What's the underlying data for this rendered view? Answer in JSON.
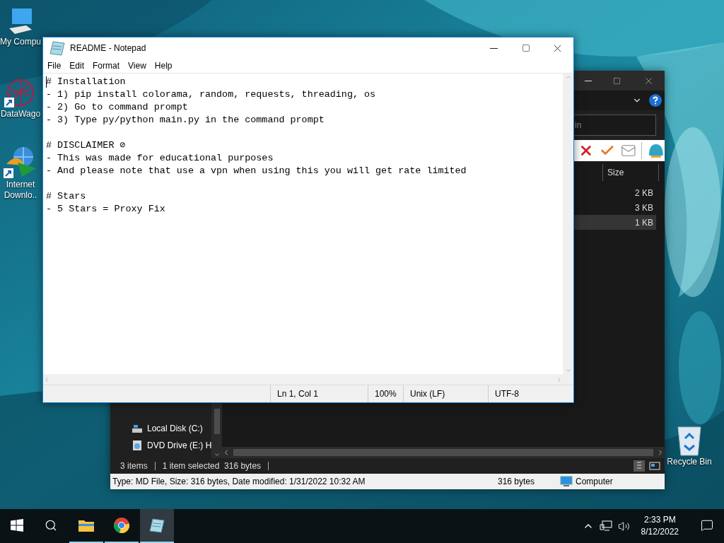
{
  "desktop_icons": [
    {
      "label": "My Compu",
      "kind": "computer"
    },
    {
      "label": "DataWago",
      "kind": "network"
    },
    {
      "label": "Internet Downlo..",
      "kind": "download"
    },
    {
      "label": "Recycle Bin",
      "kind": "recycle"
    }
  ],
  "explorer": {
    "search": {
      "placeholder": "in"
    },
    "columns": [
      "Size"
    ],
    "files": [
      {
        "size": "2 KB",
        "selected": false
      },
      {
        "size": "3 KB",
        "selected": false
      },
      {
        "size": "1 KB",
        "selected": true
      }
    ],
    "nav_items": [
      {
        "label": "Local Disk (C:)",
        "kind": "disk"
      },
      {
        "label": "DVD Drive (E:) H",
        "kind": "dvd"
      }
    ],
    "status_bar": {
      "count": "3 items",
      "selection": "1 item selected  316 bytes"
    },
    "details_bar": {
      "info": "Type: MD File, Size: 316 bytes, Date modified: 1/31/2022 10:32 AM",
      "size": "316 bytes",
      "location": "Computer"
    }
  },
  "notepad": {
    "title": "README - Notepad",
    "menu": [
      "File",
      "Edit",
      "Format",
      "View",
      "Help"
    ],
    "paragraphs": [
      [
        "# Installation",
        "- 1) pip install colorama, random, requests, threading, os",
        "- 2) Go to command prompt",
        "- 3) Type py/python main.py in the command prompt"
      ],
      [
        "# DISCLAIMER ⊘",
        "- This was made for educational purposes",
        "- And please note that use a vpn when using this you will get rate limited"
      ],
      [
        "# Stars",
        "- 5 Stars = Proxy Fix"
      ]
    ],
    "status": {
      "position": "Ln 1, Col 1",
      "zoom": "100%",
      "line_endings": "Unix (LF)",
      "encoding": "UTF-8"
    }
  },
  "taskbar": {
    "apps": [
      {
        "kind": "explorer",
        "selected": false
      },
      {
        "kind": "chrome",
        "selected": false
      },
      {
        "kind": "notepad",
        "selected": true
      }
    ],
    "time": "2:33 PM",
    "date": "8/12/2022"
  }
}
